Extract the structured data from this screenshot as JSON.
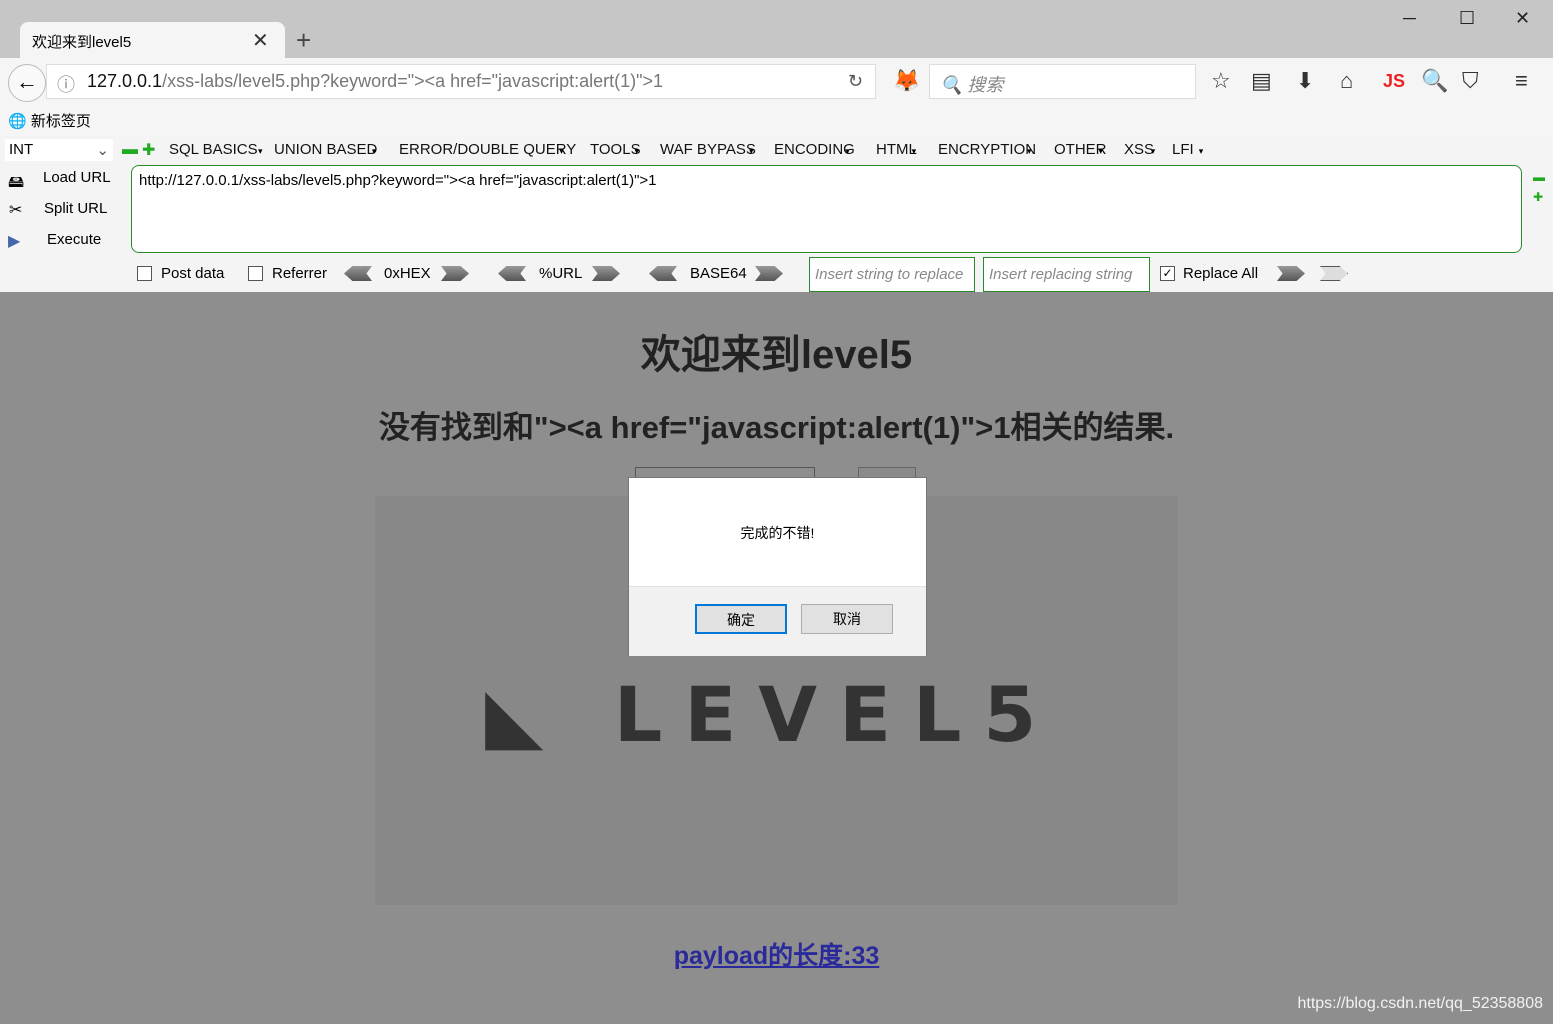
{
  "tab": {
    "title": "欢迎来到level5"
  },
  "url": {
    "host": "127.0.0.1",
    "path": "/xss-labs/level5.php?keyword=\"><a href=\"javascript:alert(1)\">1"
  },
  "search": {
    "placeholder": "搜索"
  },
  "bookmark": "新标签页",
  "hackbar": {
    "select": "INT",
    "menus": [
      "SQL BASICS",
      "UNION BASED",
      "ERROR/DOUBLE QUERY",
      "TOOLS",
      "WAF BYPASS",
      "ENCODING",
      "HTML",
      "ENCRYPTION",
      "OTHER",
      "XSS",
      "LFI"
    ],
    "load": "Load URL",
    "split": "Split URL",
    "execute": "Execute",
    "text": "http://127.0.0.1/xss-labs/level5.php?keyword=\"><a href=\"javascript:alert(1)\">1",
    "post": "Post data",
    "referrer": "Referrer",
    "hex": "0xHEX",
    "url": "%URL",
    "b64": "BASE64",
    "ins1": "Insert string to replace",
    "ins2": "Insert replacing string",
    "replace_all": "Replace All"
  },
  "page": {
    "title": "欢迎来到level5",
    "result": "没有找到和\"><a href=\"javascript:alert(1)\">1相关的结果.",
    "logo": "LEVEL5",
    "payload": "payload的长度:33"
  },
  "dialog": {
    "message": "完成的不错!",
    "ok": "确定",
    "cancel": "取消"
  },
  "watermark": "https://blog.csdn.net/qq_52358808"
}
